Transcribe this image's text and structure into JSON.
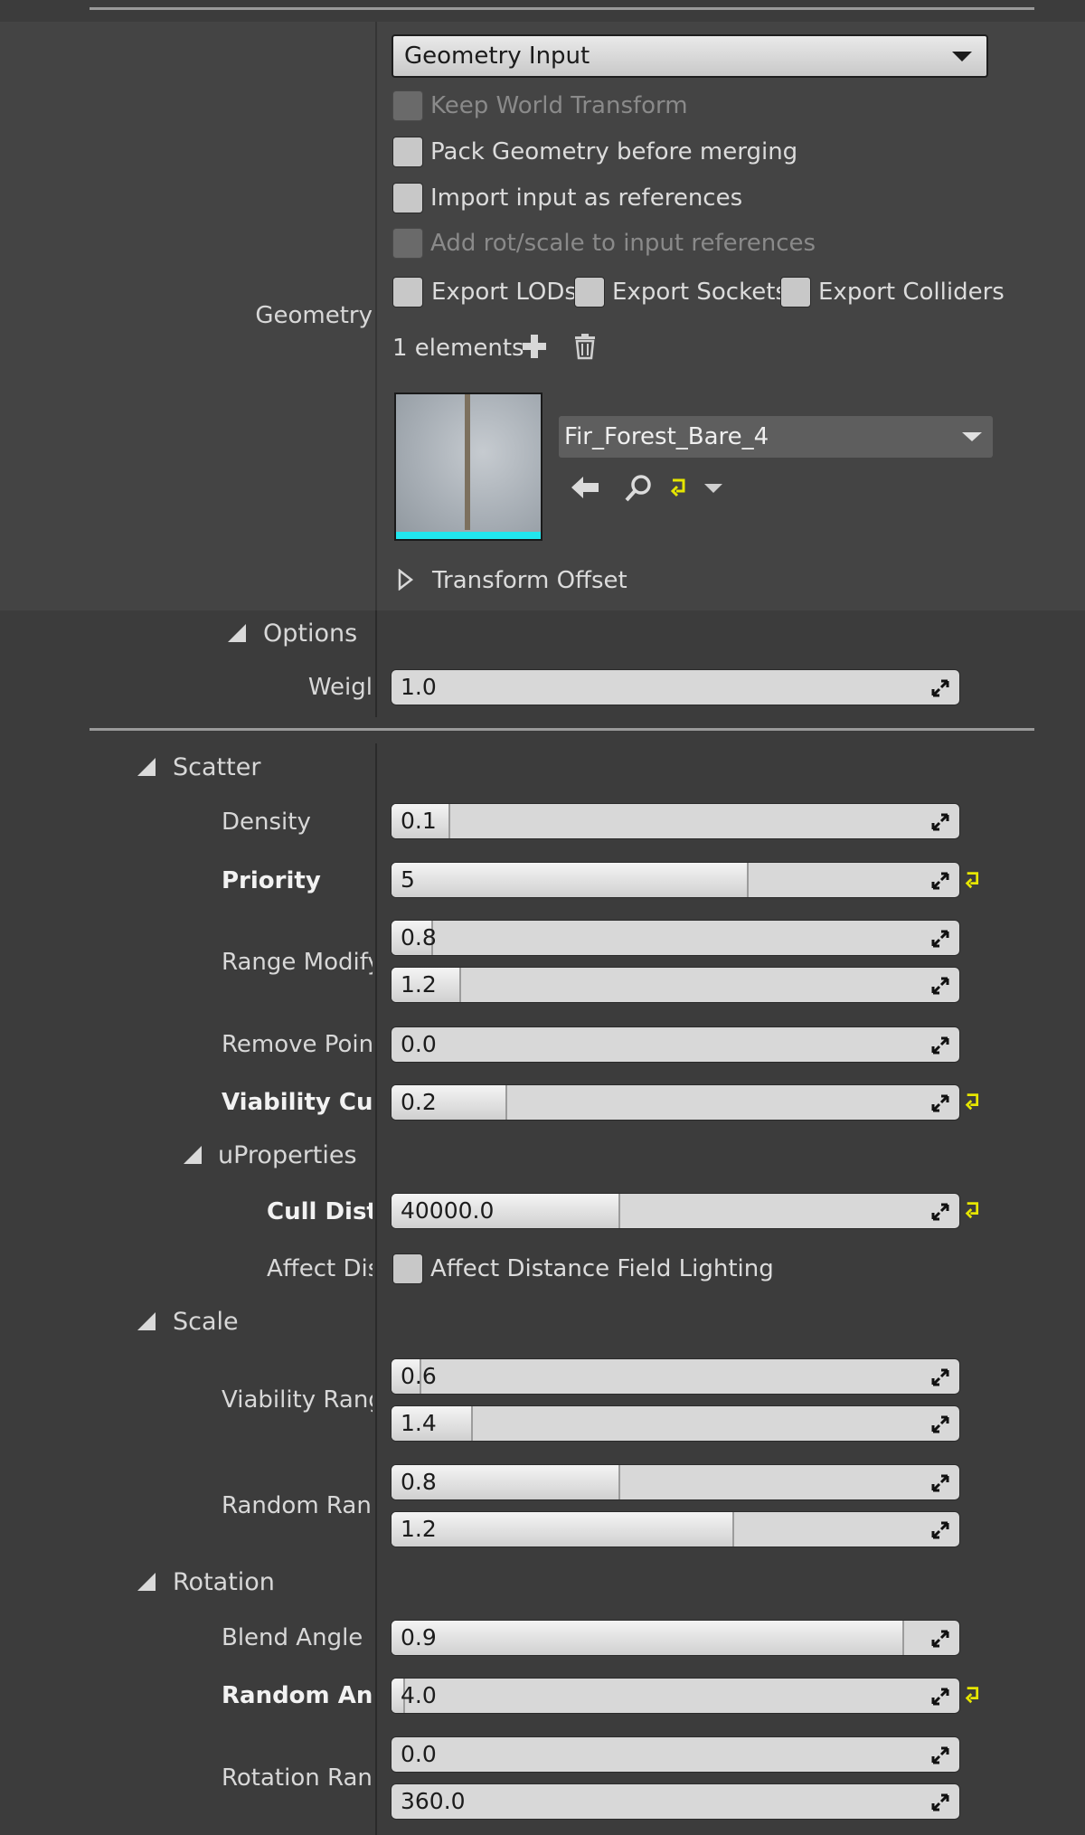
{
  "geometry": {
    "label": "Geometry",
    "input_type": "Geometry Input",
    "keep_world_transform": "Keep World Transform",
    "pack_geometry": "Pack Geometry before merging",
    "import_as_references": "Import input as references",
    "add_rot_scale": "Add rot/scale to input references",
    "export_lods": "Export LODs",
    "export_sockets": "Export Sockets",
    "export_colliders": "Export Colliders",
    "elements_count": "1 elements",
    "asset_name": "Fir_Forest_Bare_4",
    "transform_offset": "Transform Offset"
  },
  "options": {
    "header": "Options",
    "weight_label": "Weigl",
    "weight_value": "1.0"
  },
  "scatter": {
    "header": "Scatter",
    "density_label": "Density",
    "density_value": "0.1",
    "priority_label": "Priority",
    "priority_value": "5",
    "range_modify_label": "Range Modify",
    "range_modify_min": "0.8",
    "range_modify_max": "1.2",
    "remove_point_label": "Remove Point",
    "remove_point_value": "0.0",
    "viability_cut_label": "Viability Cut C",
    "viability_cut_value": "0.2"
  },
  "uproperties": {
    "header": "uProperties",
    "cull_distance_label": "Cull Dista",
    "cull_distance_value": "40000.0",
    "affect_label": "Affect Dis",
    "affect_checkbox": "Affect Distance Field Lighting"
  },
  "scale": {
    "header": "Scale",
    "viability_range_label": "Viability Rang",
    "viability_range_min": "0.6",
    "viability_range_max": "1.4",
    "random_range_label": "Random Rang",
    "random_range_min": "0.8",
    "random_range_max": "1.2"
  },
  "rotation": {
    "header": "Rotation",
    "blend_angle_label": "Blend Angle",
    "blend_angle_value": "0.9",
    "random_angle_label": "Random Angle",
    "random_angle_value": "4.0",
    "rotation_range_label": "Rotation Rang",
    "rotation_range_min": "0.0",
    "rotation_range_max": "360.0"
  },
  "slider_fill": {
    "density": 0.1,
    "priority": 0.625,
    "range_min": 0.07,
    "range_max": 0.12,
    "viability_cut": 0.2,
    "cull": 0.4,
    "vr_min": 0.05,
    "vr_max": 0.14,
    "rr_min": 0.4,
    "rr_max": 0.6,
    "blend": 0.9,
    "random_angle": 0.02
  },
  "colors": {
    "accent_cyan": "#22e6ee",
    "reset_yellow": "#e6e600",
    "panel": "#3c3c3c"
  }
}
